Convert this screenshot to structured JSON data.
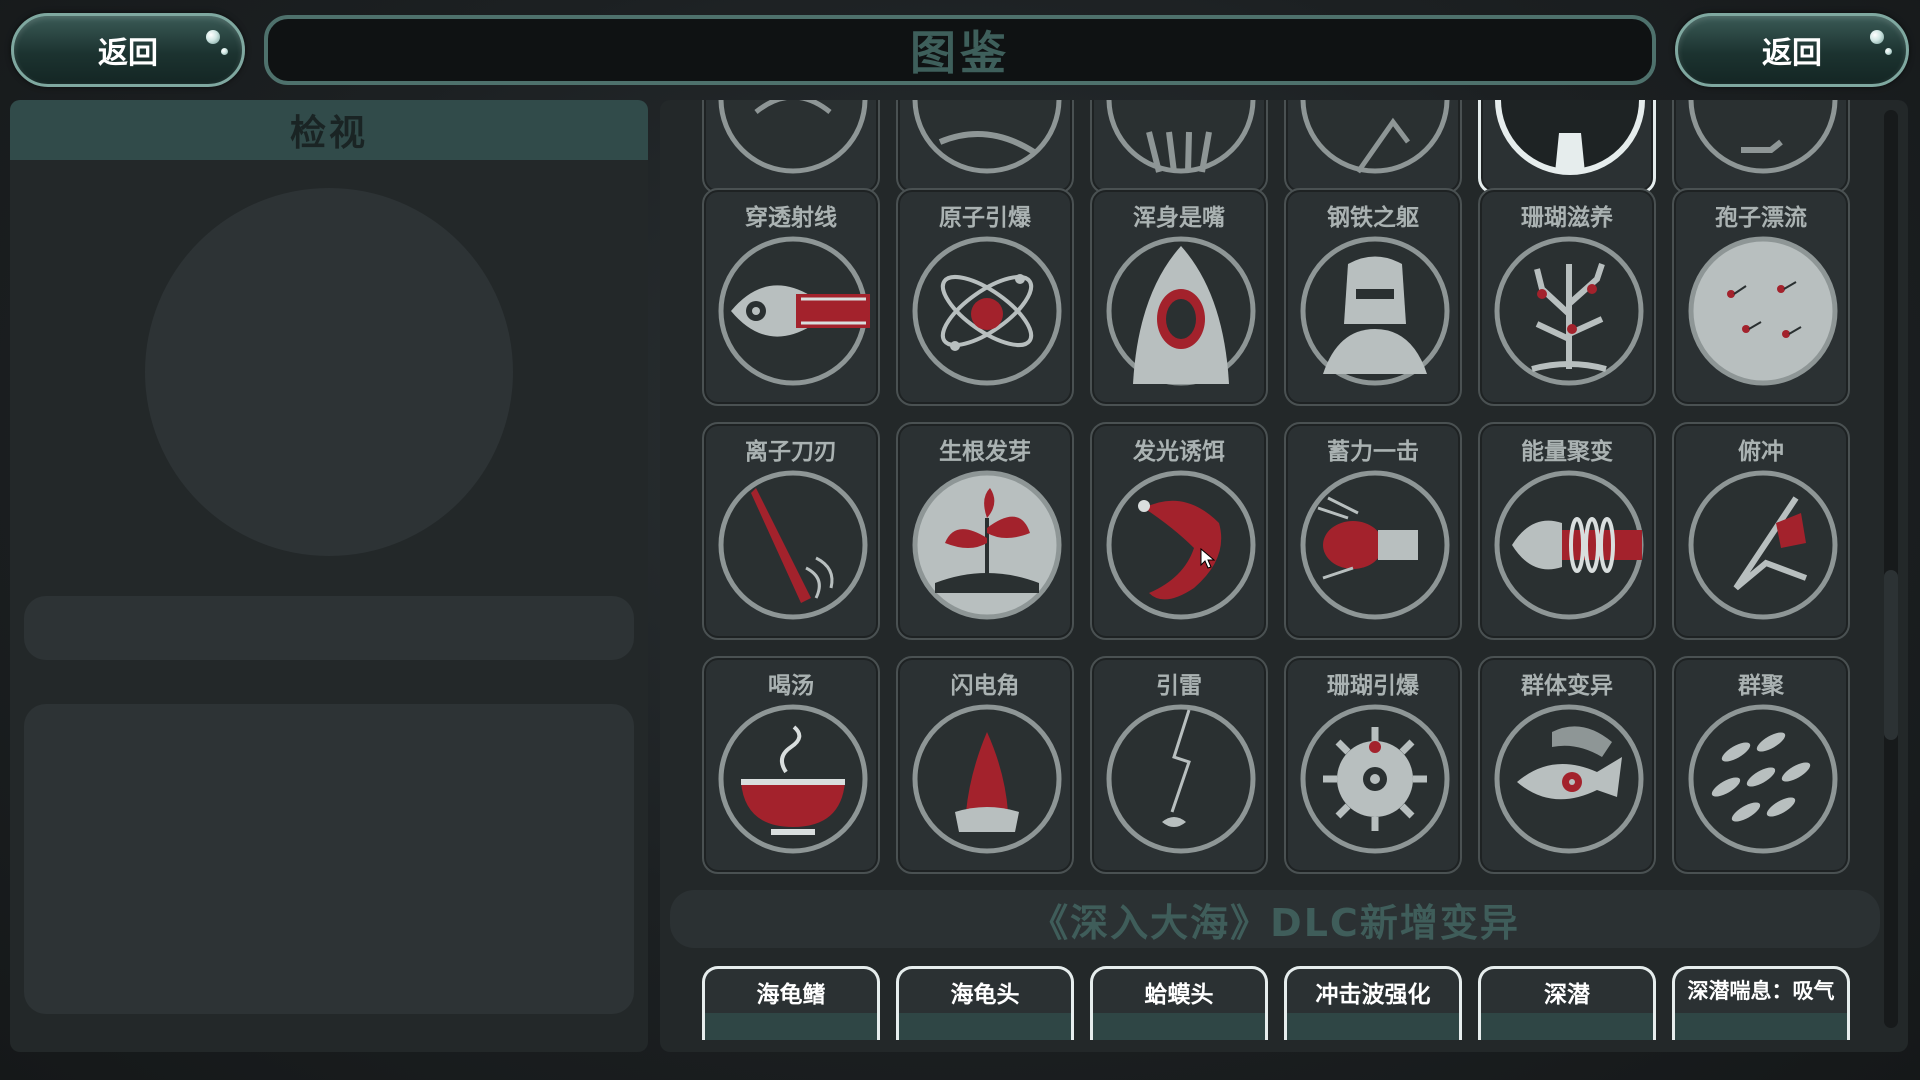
{
  "header": {
    "back_left": "返回",
    "back_right": "返回",
    "title": "图鉴"
  },
  "inspect": {
    "title": "检视"
  },
  "grid_rows": [
    [
      "穿透射线",
      "原子引爆",
      "浑身是嘴",
      "钢铁之躯",
      "珊瑚滋养",
      "孢子漂流"
    ],
    [
      "离子刀刃",
      "生根发芽",
      "发光诱饵",
      "蓄力一击",
      "能量聚变",
      "俯冲"
    ],
    [
      "喝汤",
      "闪电角",
      "引雷",
      "珊瑚引爆",
      "群体变异",
      "群聚"
    ]
  ],
  "dlc": {
    "banner": "《深入大海》DLC新增变异",
    "items": [
      "海龟鳍",
      "海龟头",
      "蛤蟆头",
      "冲击波强化",
      "深潜",
      "深潜喘息：吸气"
    ]
  },
  "colors": {
    "accent_teal": "#4e716c",
    "card_bg": "#2b3133",
    "icon_red": "#a3222c"
  }
}
